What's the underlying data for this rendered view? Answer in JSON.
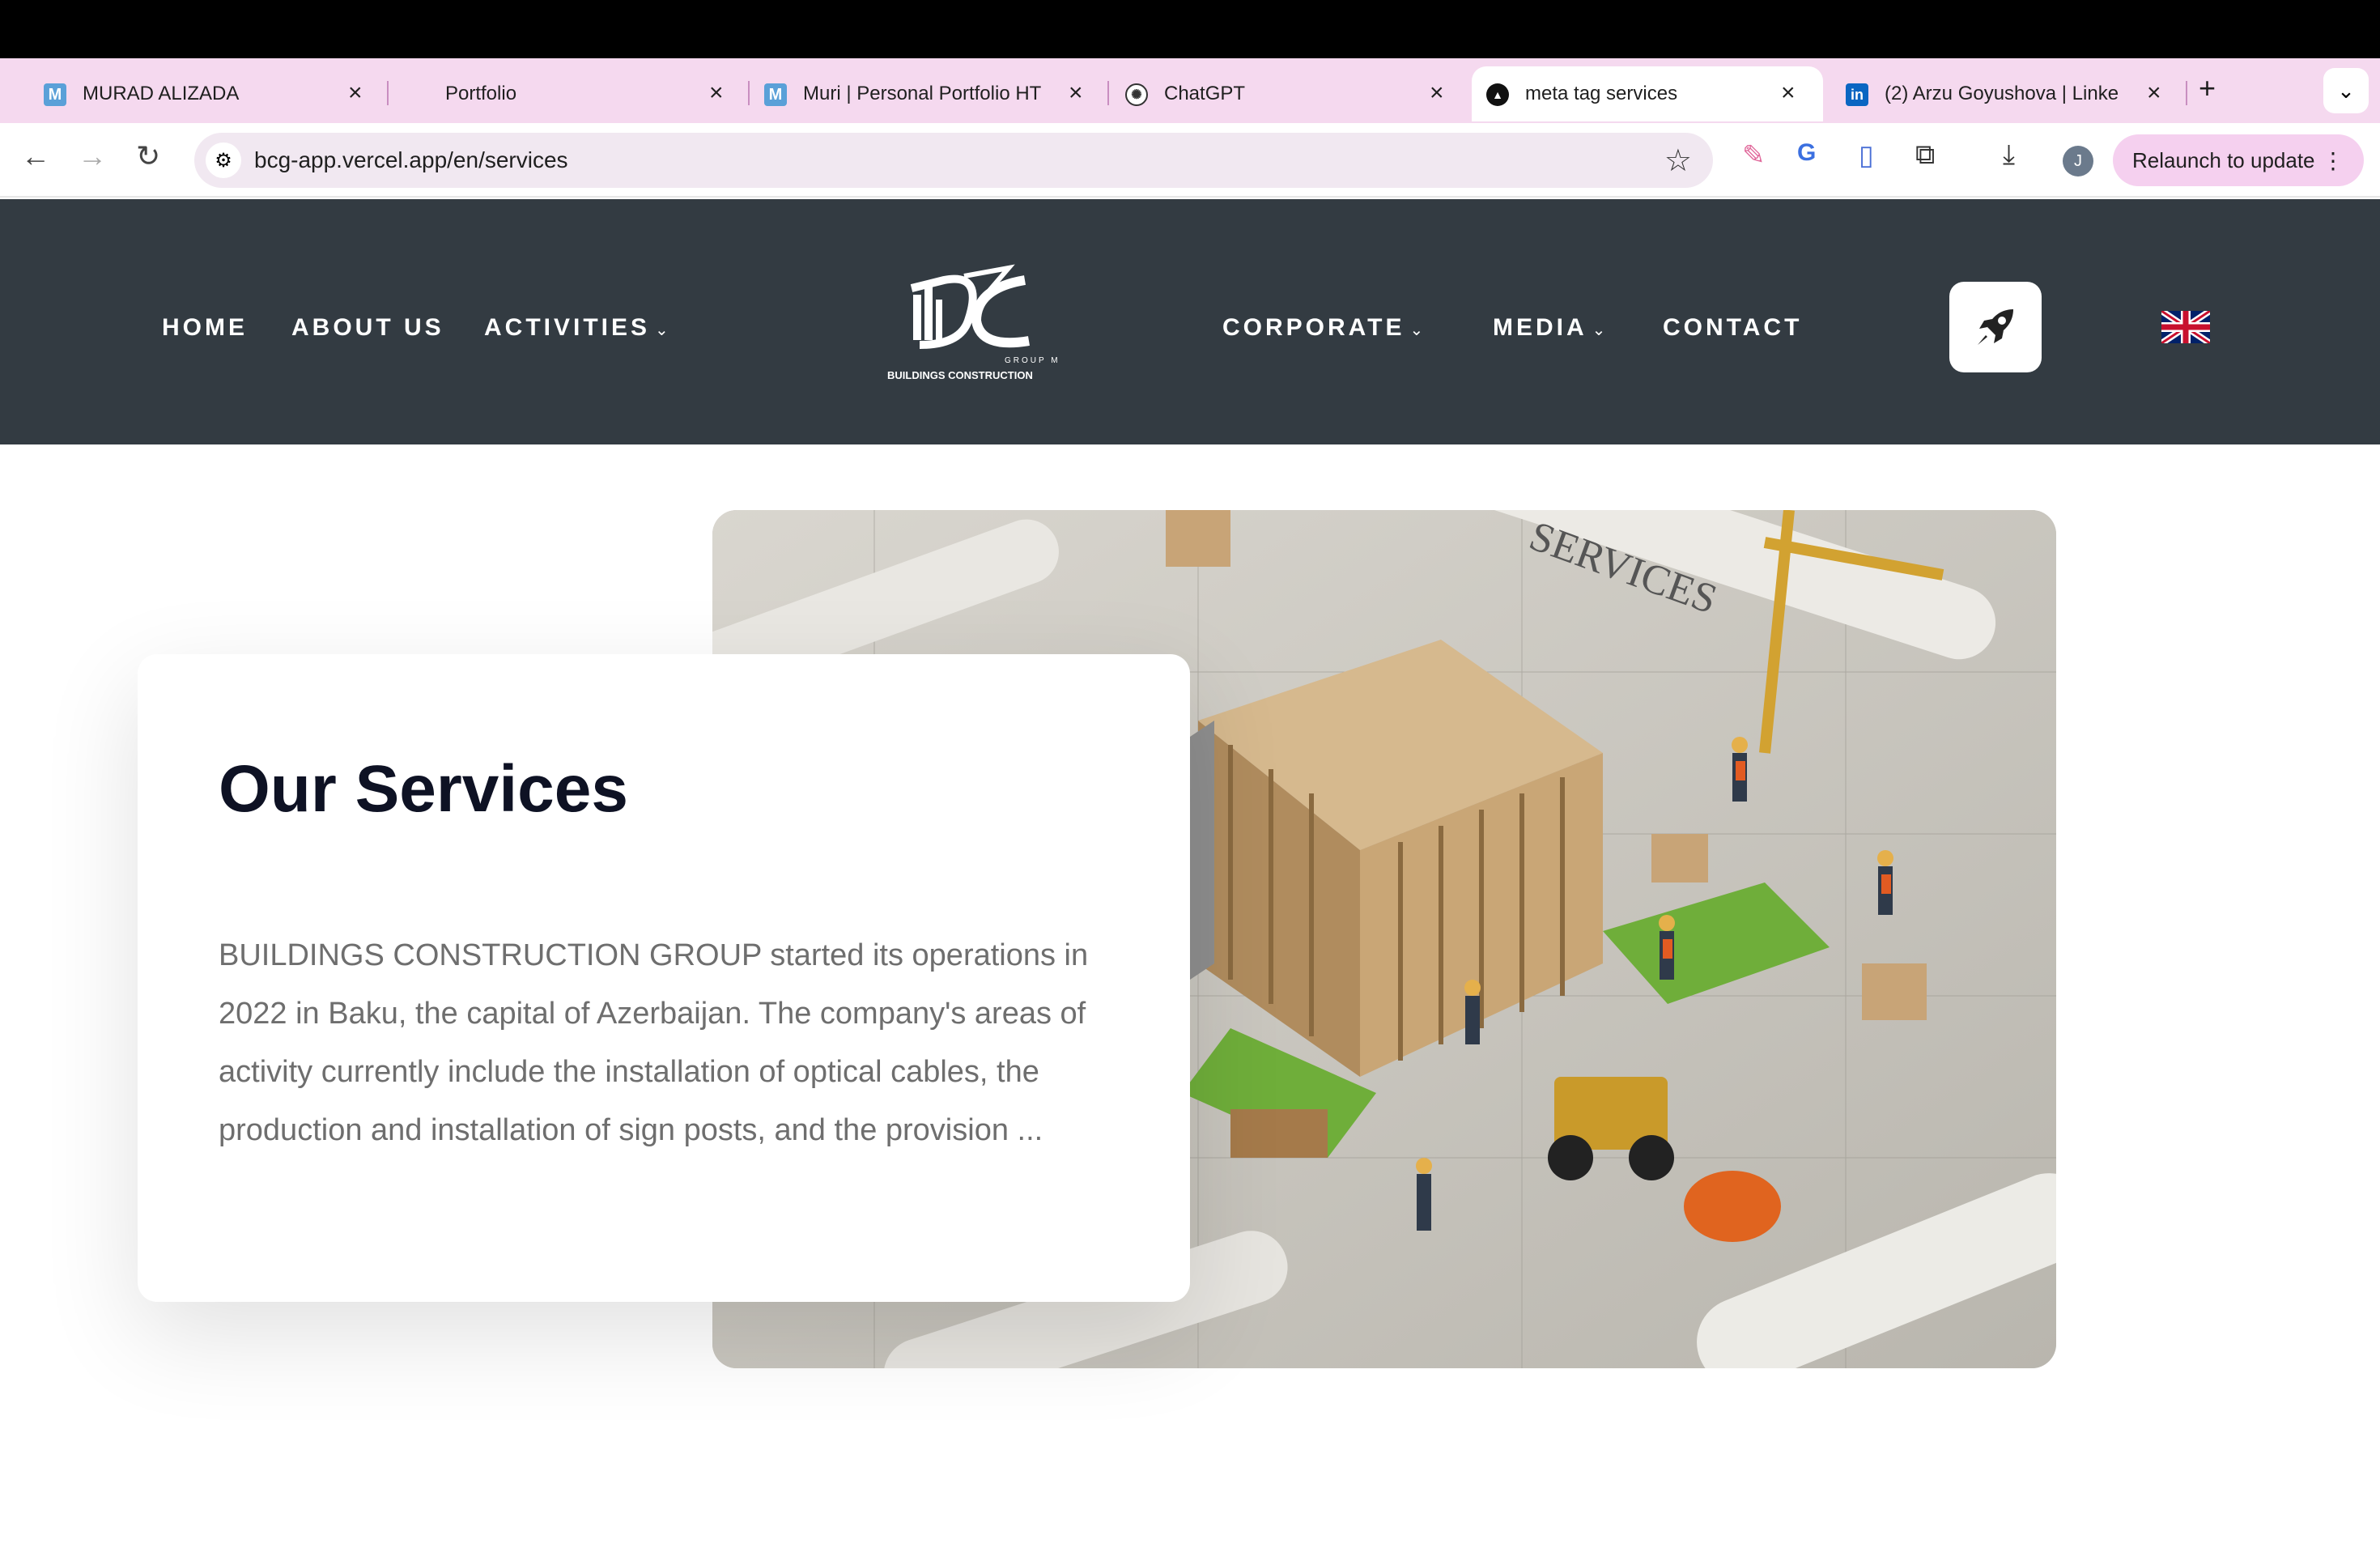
{
  "browser": {
    "tabs": [
      {
        "title": "MURAD ALIZADA",
        "favicon": "M"
      },
      {
        "title": "Portfolio",
        "favicon": ""
      },
      {
        "title": "Muri | Personal Portfolio HT",
        "favicon": "M"
      },
      {
        "title": "ChatGPT",
        "favicon": "chatgpt-icon"
      },
      {
        "title": "meta tag services",
        "favicon": "vercel-icon",
        "active": true
      },
      {
        "title": "(2) Arzu Goyushova | Linke",
        "favicon": "in"
      }
    ],
    "url": "bcg-app.vercel.app/en/services",
    "relaunch_label": "Relaunch to update",
    "avatar_letter": "J"
  },
  "site": {
    "nav_left": [
      "HOME",
      "ABOUT US",
      "ACTIVITIES"
    ],
    "nav_right": [
      "CORPORATE",
      "MEDIA",
      "CONTACT"
    ],
    "logo_small": "GROUP MMC",
    "logo_text": "BUILDINGS CONSTRUCTION",
    "header_bg": "#333b42"
  },
  "hero": {
    "title": "Our Services",
    "body": "BUILDINGS CONSTRUCTION GROUP started its operations in 2022 in Baku, the capital of Azerbaijan. The company's areas of activity currently include the installation of optical cables, the production and installation of sign posts, and the provision ...",
    "image_caption": "SERVICES"
  }
}
